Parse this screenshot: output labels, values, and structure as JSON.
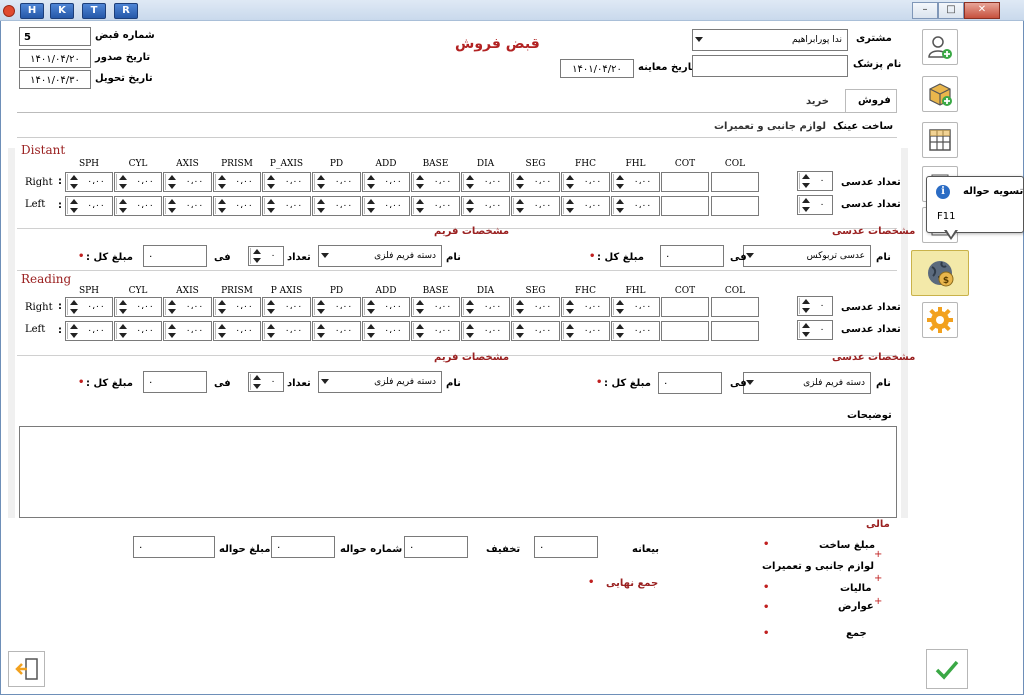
{
  "titlebar": {
    "buttons": [
      "H",
      "K",
      "T",
      "R"
    ]
  },
  "header": {
    "title": "قبض فروش",
    "receipt_no_label": "شماره قبض",
    "receipt_no": "5",
    "issue_date_label": "تاریخ صدور",
    "issue_date": "۱۴۰۱/۰۴/۲۰",
    "delivery_date_label": "تاریخ تحویل",
    "delivery_date": "۱۴۰۱/۰۴/۳۰",
    "exam_date_label": "تاریخ معاینه",
    "exam_date": "۱۴۰۱/۰۴/۲۰",
    "customer_label": "مشتری",
    "customer": "ندا پورابراهیم",
    "doctor_label": "نام پزشک",
    "doctor": ""
  },
  "tabs": {
    "sale": "فروش",
    "purchase": "خرید",
    "sub_glasses": "ساخت عینک",
    "sub_accessories": "لوازم جانبی و تعمیرات"
  },
  "columns": [
    "SPH",
    "CYL",
    "AXIS",
    "PRISM",
    "P_AXIS",
    "PD",
    "ADD",
    "BASE",
    "DIA",
    "SEG",
    "FHC",
    "FHL",
    "COT",
    "COL"
  ],
  "columns_reading": [
    "SPH",
    "CYL",
    "AXIS",
    "PRISM",
    "P AXIS",
    "PD",
    "ADD",
    "BASE",
    "DIA",
    "SEG",
    "FHC",
    "FHL",
    "COT",
    "COL"
  ],
  "spin_value": "۰،۰۰",
  "distant": {
    "title": "Distant",
    "right_label": "Right",
    "left_label": "Left",
    "lens_count_label": "تعداد عدسی",
    "lens_count_right": "۰",
    "lens_count_left": "۰",
    "lens_section": "مشخصات عدسی",
    "frame_section": "مشخصات فریم",
    "lens_name_label": "نام",
    "lens_name": "عدسی تربوکس",
    "lens_price_label": "فی",
    "lens_price": "۰",
    "lens_total_label": "مبلغ کل :",
    "lens_total": "۰",
    "frame_name_label": "نام",
    "frame_name": "دسته فریم فلزی",
    "frame_qty_label": "تعداد",
    "frame_qty": "۰",
    "frame_price_label": "فی",
    "frame_price": "۰",
    "frame_total_label": "مبلغ کل :",
    "frame_total": "۰"
  },
  "reading": {
    "title": "Reading",
    "right_label": "Right",
    "left_label": "Left",
    "lens_count_label": "تعداد عدسی",
    "lens_count_right": "۰",
    "lens_count_left": "۰",
    "lens_section": "مشخصات عدسی",
    "frame_section": "مشخصات فریم",
    "lens_name_label": "نام",
    "lens_name": "دسته فریم فلزی",
    "lens_price_label": "فی",
    "lens_price": "۰",
    "lens_total_label": "مبلغ کل :",
    "lens_total": "۰",
    "frame_name_label": "نام",
    "frame_name": "دسته فریم فلزی",
    "frame_qty_label": "تعداد",
    "frame_qty": "۰",
    "frame_price_label": "فی",
    "frame_price": "۰",
    "frame_total_label": "مبلغ کل :",
    "frame_total": "۰"
  },
  "notes_label": "توضیحات",
  "finance": {
    "title": "مالی",
    "build_amount": "مبلغ ساخت",
    "accessories": "لوازم جانبی و تعمیرات",
    "tax": "مالیات",
    "duties": "عوارض",
    "sum": "جمع",
    "deposit_label": "بیعانه",
    "deposit": "۰",
    "discount_label": "تخفیف",
    "discount": "۰",
    "voucher_no_label": "شماره حواله",
    "voucher_no": "۰",
    "voucher_amount_label": "مبلغ حواله",
    "voucher_amount": "۰",
    "final_total_label": "جمع نهایی",
    "dot": "•",
    "plus": "+"
  },
  "tooltip": {
    "title": "تسویه حواله",
    "shortcut": "F11"
  },
  "colors": {
    "accent_red": "#9a2020",
    "title_red": "#b22222",
    "highlight": "#f3e9a9"
  }
}
